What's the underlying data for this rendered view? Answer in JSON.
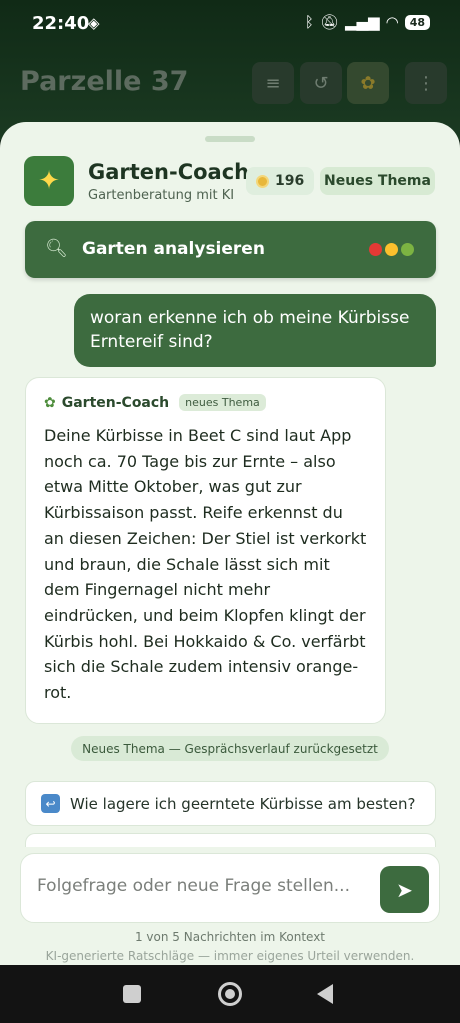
{
  "status": {
    "time": "22:40",
    "battery": "48"
  },
  "app": {
    "title": "Parzelle 37"
  },
  "coach": {
    "name": "Garten-Coach",
    "subtitle": "Gartenberatung mit KI",
    "coins": "196",
    "new_topic_label": "Neues Thema"
  },
  "analyze": {
    "label": "Garten analysieren"
  },
  "chat": {
    "user_message": "woran erkenne ich ob meine Kürbisse Erntereif sind?",
    "coach_name": "Garten-Coach",
    "coach_tag": "neues Thema",
    "coach_message": "Deine Kürbisse in Beet C sind laut App noch ca. 70 Tage bis zur Ernte – also etwa Mitte Oktober, was gut zur Kürbissaison passt. Reife erkennst du an diesen Zeichen: Der Stiel ist verkorkt und braun, die Schale lässt sich mit dem Fingernagel nicht mehr eindrücken, und beim Klopfen klingt der Kürbis hohl. Bei Hokkaido & Co. verfärbt sich die Schale zudem intensiv orange-rot.",
    "reset_notice": "Neues Thema — Gesprächsverlauf zurückgesetzt"
  },
  "suggestions": [
    {
      "label": "Wie lagere ich geerntete Kürbisse am besten?"
    }
  ],
  "input": {
    "placeholder": "Folgefrage oder neue Frage stellen..."
  },
  "footer": {
    "context_info": "1 von 5 Nachrichten im Kontext",
    "disclaimer": "KI-generierte Ratschläge — immer eigenes Urteil verwenden."
  },
  "colors": {
    "accent": "#3d6b3f",
    "sheet_bg": "#edf5ea",
    "dot_red": "#e53935",
    "dot_yellow": "#fbc02d",
    "dot_green": "#7cb342"
  }
}
